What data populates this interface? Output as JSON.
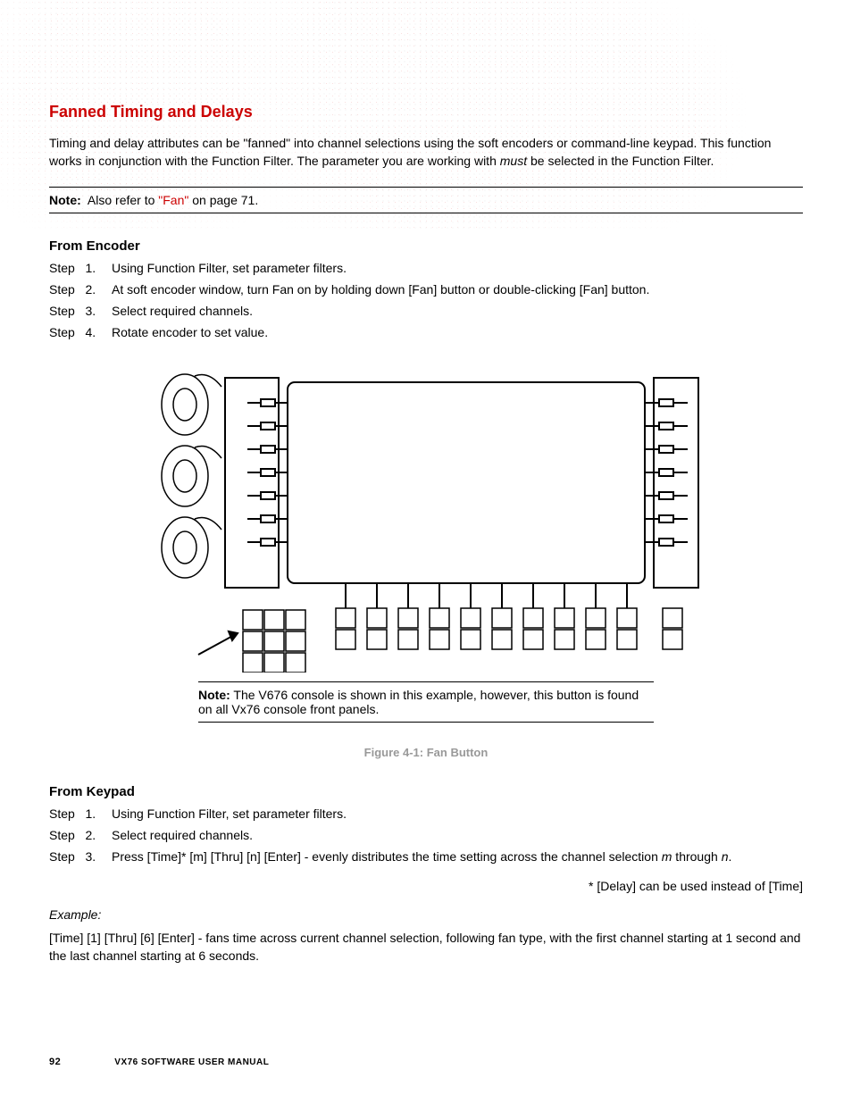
{
  "heading": "Fanned Timing and Delays",
  "intro": "Timing and delay attributes can be \"fanned\" into channel selections using the soft encoders or command-line keypad. This function works in conjunction with the Function Filter. The parameter you are working with ",
  "intro_em": "must",
  "intro_tail": " be selected in the Function Filter.",
  "note1_label": "Note:",
  "note1_text_a": "Also refer to ",
  "note1_link": "\"Fan\"",
  "note1_text_b": " on page 71.",
  "sec_encoder": "From Encoder",
  "enc_steps": [
    "Using Function Filter, set parameter filters.",
    "At soft encoder window, turn Fan on by holding down [Fan] button or double-clicking [Fan] button.",
    "Select required channels.",
    "Rotate encoder to set value."
  ],
  "fig_note_label": "Note:",
  "fig_note_text": "The V676 console is shown in this example, however, this button is found on all Vx76 console front panels.",
  "fig_caption": "Figure 4-1:  Fan Button",
  "sec_keypad": "From Keypad",
  "key_steps": [
    "Using Function Filter, set parameter filters.",
    "Select required channels."
  ],
  "key_step3_a": "Press [Time]* [m] [Thru] [n] [Enter] - evenly distributes the time setting across the channel selection ",
  "key_step3_m": "m",
  "key_step3_b": " through ",
  "key_step3_n": "n",
  "key_step3_c": ".",
  "delay_note": "* [Delay] can be used instead of [Time]",
  "example_label": "Example:",
  "example_text": "[Time] [1] [Thru] [6] [Enter] - fans time across current channel selection, following fan type, with the first channel starting at 1 second and the last channel starting at 6 seconds.",
  "step_word": "Step",
  "footer_page": "92",
  "footer_title": "VX76 SOFTWARE USER MANUAL"
}
